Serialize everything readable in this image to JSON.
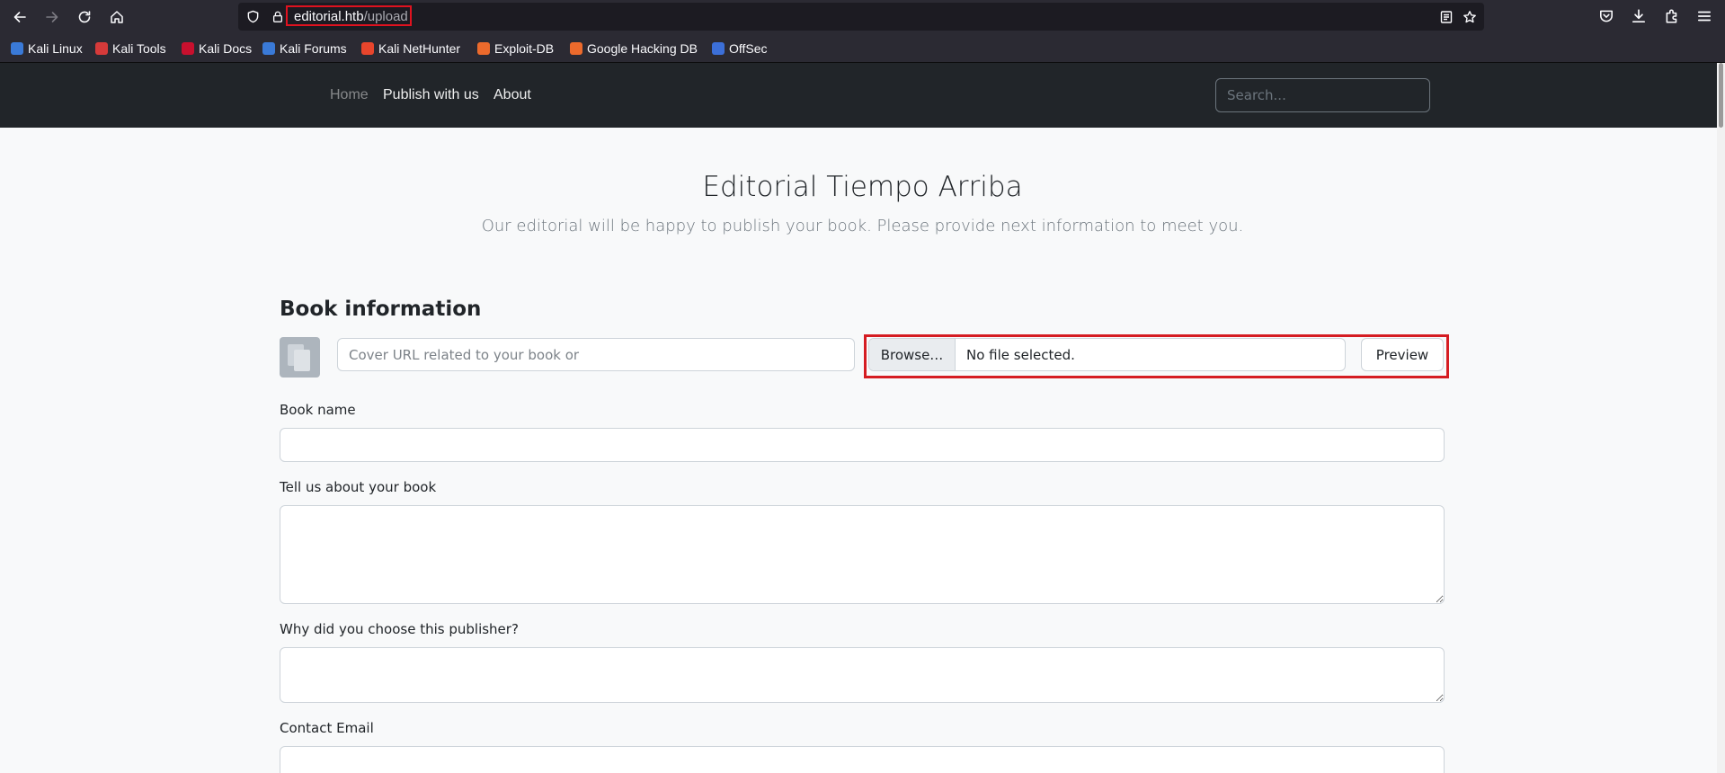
{
  "browser": {
    "url_host": "editorial.htb",
    "url_path": "/upload",
    "bookmarks": [
      {
        "label": "Kali Linux",
        "icon": "kali-linux-icon",
        "color": "#3a7ad8"
      },
      {
        "label": "Kali Tools",
        "icon": "kali-tools-icon",
        "color": "#d63a3a"
      },
      {
        "label": "Kali Docs",
        "icon": "kali-docs-icon",
        "color": "#c8102e"
      },
      {
        "label": "Kali Forums",
        "icon": "kali-forums-icon",
        "color": "#3a7ad8"
      },
      {
        "label": "Kali NetHunter",
        "icon": "kali-nethunter-icon",
        "color": "#e8452c"
      },
      {
        "label": "Exploit-DB",
        "icon": "exploit-db-icon",
        "color": "#ec6a2c"
      },
      {
        "label": "Google Hacking DB",
        "icon": "google-hacking-db-icon",
        "color": "#ec6a2c"
      },
      {
        "label": "OffSec",
        "icon": "offsec-icon",
        "color": "#3c6fd8"
      }
    ]
  },
  "site": {
    "nav": {
      "home": "Home",
      "publish": "Publish with us",
      "about": "About",
      "search_placeholder": "Search..."
    },
    "hero": {
      "title": "Editorial Tiempo Arriba",
      "subtitle": "Our editorial will be happy to publish your book. Please provide next information to meet you."
    },
    "form": {
      "section_title": "Book information",
      "cover_url_placeholder": "Cover URL related to your book or",
      "browse_label": "Browse…",
      "file_status": "No file selected.",
      "preview_label": "Preview",
      "book_name_label": "Book name",
      "about_label": "Tell us about your book",
      "why_label": "Why did you choose this publisher?",
      "email_label": "Contact Email"
    }
  },
  "colors": {
    "highlight": "#d51c22",
    "navbar_bg": "#212529",
    "browser_bg": "#2b2a33"
  }
}
